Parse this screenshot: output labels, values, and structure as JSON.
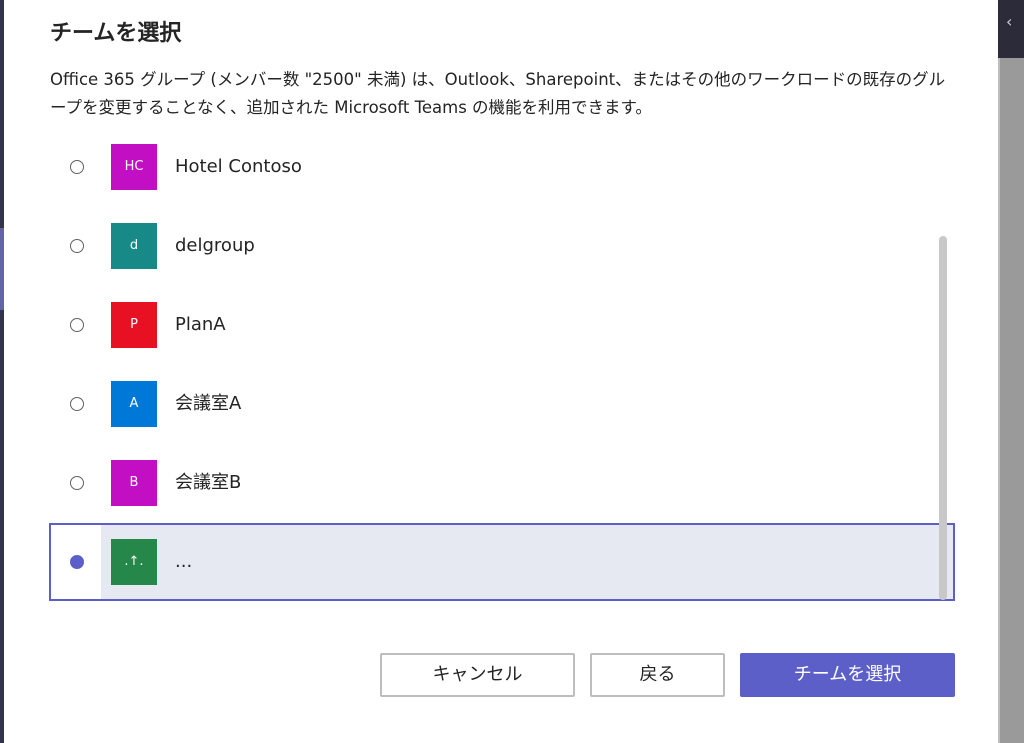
{
  "dialog": {
    "title": "チームを選択",
    "description": "Office 365 グループ (メンバー数 \"2500\" 未満) は、Outlook、Sharepoint、またはその他のワークロードの既存のグループを変更することなく、追加された Microsoft Teams の機能を利用できます。"
  },
  "teams": [
    {
      "initials": "HC",
      "name": "Hotel Contoso",
      "color": "#c30fc3",
      "selected": false
    },
    {
      "initials": "d",
      "name": "delgroup",
      "color": "#178a87",
      "selected": false
    },
    {
      "initials": "P",
      "name": "PlanA",
      "color": "#e81123",
      "selected": false
    },
    {
      "initials": "A",
      "name": "会議室A",
      "color": "#0078d7",
      "selected": false
    },
    {
      "initials": "B",
      "name": "会議室B",
      "color": "#c30fc3",
      "selected": false
    },
    {
      "initials": ".↑.",
      "name": "...",
      "color": "#25884a",
      "selected": true
    }
  ],
  "buttons": {
    "cancel": "キャンセル",
    "back": "戻る",
    "select": "チームを選択"
  },
  "colors": {
    "accent": "#5b5fc7",
    "selected_row": "#e6e8f2"
  },
  "icons": {
    "back_glyph": "‹"
  }
}
